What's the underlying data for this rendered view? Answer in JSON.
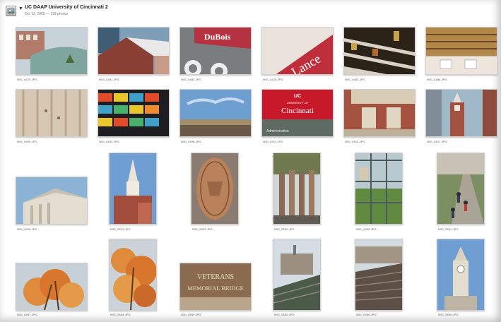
{
  "header": {
    "title": "UC DAAP University of Cincinnati 2",
    "meta": "Oct 12, 2005 — 138 photos",
    "album_icon": "album-icon",
    "disclosure_icon": "disclosure-triangle-icon"
  },
  "photos": [
    {
      "caption": "IMG_0470.JPG"
    },
    {
      "caption": "IMG_0481.JPG"
    },
    {
      "caption": "IMG_0483.JPG"
    },
    {
      "caption": "IMG_0478.JPG"
    },
    {
      "caption": "IMG_0482.JPG"
    },
    {
      "caption": "IMG_0486.JPG"
    },
    {
      "caption": "IMG_0490.JPG"
    },
    {
      "caption": "IMG_0492.JPG"
    },
    {
      "caption": "IMG_0498.JPG"
    },
    {
      "caption": "IMG_0511.JPG"
    },
    {
      "caption": "IMG_0513.JPG"
    },
    {
      "caption": "IMG_0517.JPG"
    },
    {
      "caption": "IMG_0518.JPG"
    },
    {
      "caption": "IMG_0521.JPG"
    },
    {
      "caption": "IMG_0523.JPG"
    },
    {
      "caption": "IMG_0530.JPG"
    },
    {
      "caption": "IMG_0536.JPG"
    },
    {
      "caption": "IMG_0541.JPG"
    },
    {
      "caption": "IMG_0547.JPG"
    },
    {
      "caption": "IMG_0548.JPG"
    },
    {
      "caption": "IMG_0549.JPG"
    },
    {
      "caption": "IMG_0552.JPG"
    },
    {
      "caption": "IMG_0556.JPG"
    },
    {
      "caption": "IMG_0559.JPG"
    }
  ],
  "signs": {
    "dubois": "DuBois",
    "lance": "Lance",
    "university_of": "UNIVERSITY OF",
    "cincinnati": "Cincinnati",
    "administration": "Administration",
    "veterans_1": "VETERANS",
    "veterans_2": "MEMORIAL BRIDGE"
  }
}
